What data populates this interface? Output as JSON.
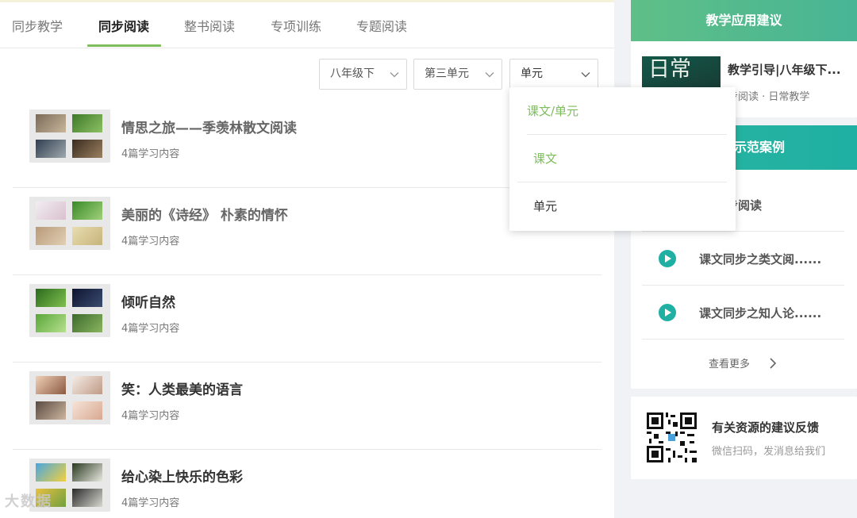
{
  "tabs": [
    "同步教学",
    "同步阅读",
    "整书阅读",
    "专项训练",
    "专题阅读"
  ],
  "active_tab_index": 1,
  "filters": {
    "grade": "八年级下",
    "unit": "第三单元",
    "type": "单元"
  },
  "dropdown": {
    "options": [
      "课文/单元",
      "课文",
      "单元"
    ],
    "highlighted": [
      "课文/单元",
      "课文"
    ]
  },
  "list": [
    {
      "title": "情思之旅——季羡林散文阅读",
      "sub": "4篇学习内容"
    },
    {
      "title": "美丽的《诗经》 朴素的情怀",
      "sub": "4篇学习内容"
    },
    {
      "title": "倾听自然",
      "sub": "4篇学习内容"
    },
    {
      "title": "笑：人类最美的语言",
      "sub": "4篇学习内容"
    },
    {
      "title": "给心染上快乐的色彩",
      "sub": "4篇学习内容"
    }
  ],
  "suggest_card": {
    "header": "教学应用建议",
    "image_text": "日常",
    "title": "教学引导|八年级下...",
    "meta": "步阅读 · 日常教学"
  },
  "case_card": {
    "header": "示范案例",
    "items": [
      "步阅读",
      "课文同步之类文阅......",
      "课文同步之知人论......"
    ],
    "more": "查看更多"
  },
  "feedback_card": {
    "title": "有关资源的建议反馈",
    "sub": "微信扫码，发消息给我们"
  },
  "watermark": "大数据"
}
